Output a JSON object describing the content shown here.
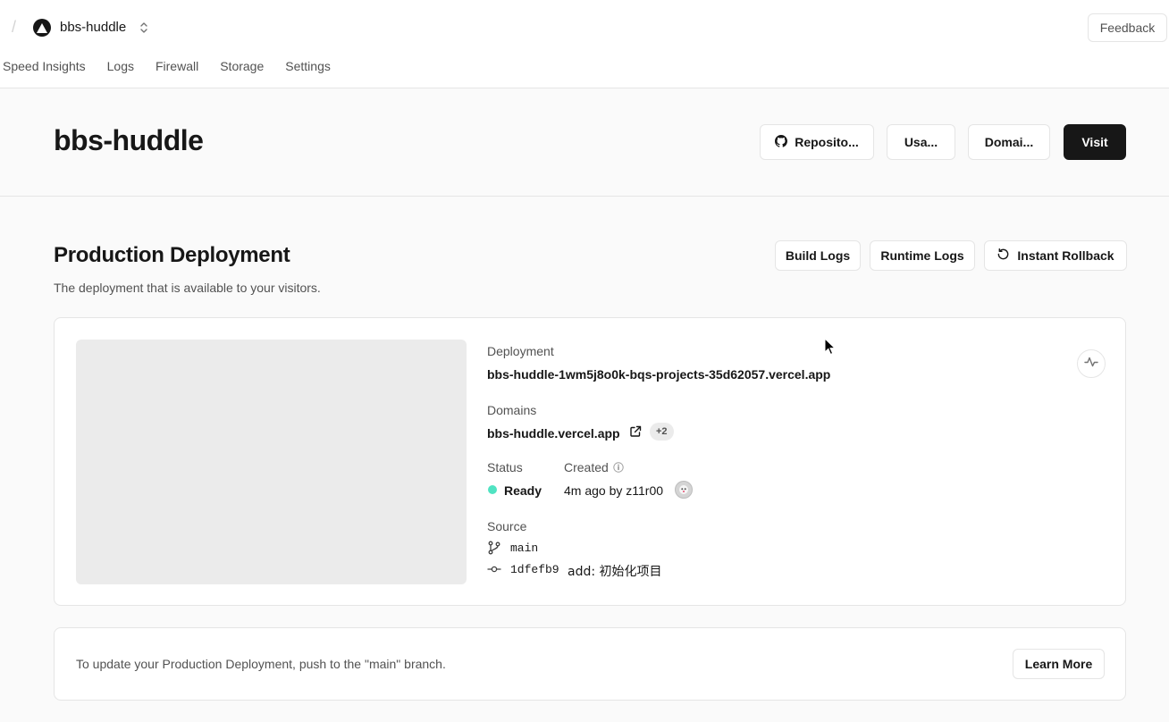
{
  "topbar": {
    "separator": "/",
    "project_name": "bbs-huddle",
    "feedback_label": "Feedback",
    "tabs": [
      "Speed Insights",
      "Logs",
      "Firewall",
      "Storage",
      "Settings"
    ]
  },
  "header": {
    "title": "bbs-huddle",
    "repository_label": "Reposito...",
    "usage_label": "Usa...",
    "domains_label": "Domai...",
    "visit_label": "Visit"
  },
  "production": {
    "title": "Production Deployment",
    "subtitle": "The deployment that is available to your visitors.",
    "build_logs_label": "Build Logs",
    "runtime_logs_label": "Runtime Logs",
    "rollback_label": "Instant Rollback"
  },
  "deployment": {
    "deployment_label": "Deployment",
    "deployment_url": "bbs-huddle-1wm5j8o0k-bqs-projects-35d62057.vercel.app",
    "domains_label": "Domains",
    "domain": "bbs-huddle.vercel.app",
    "domains_extra": "+2",
    "status_label": "Status",
    "status_value": "Ready",
    "created_label": "Created",
    "created_value": "4m ago by z11r00",
    "source_label": "Source",
    "branch": "main",
    "commit_hash": "1dfefb9",
    "commit_message": "add: 初始化项目"
  },
  "notice": {
    "text": "To update your Production Deployment, push to the \"main\" branch.",
    "learn_more_label": "Learn More"
  },
  "colors": {
    "status_ready": "#50e3c2",
    "primary_button": "#171717"
  }
}
